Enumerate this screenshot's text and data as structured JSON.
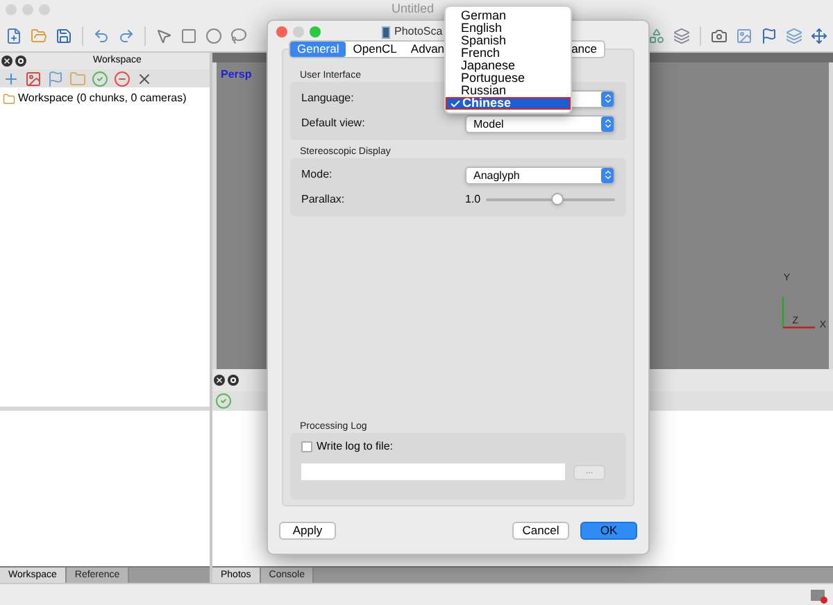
{
  "window": {
    "title": "Untitled"
  },
  "workspace_panel": {
    "title": "Workspace",
    "tree": [
      {
        "label": "Workspace (0 chunks, 0 cameras)"
      }
    ],
    "tabs": [
      {
        "label": "Workspace",
        "selected": true
      },
      {
        "label": "Reference",
        "selected": false
      }
    ]
  },
  "viewport": {
    "tab": "Persp",
    "axes": {
      "y": "Y",
      "z": "Z",
      "x": "X"
    }
  },
  "photos_panel": {
    "tabs": [
      {
        "label": "Photos",
        "selected": true
      },
      {
        "label": "Console",
        "selected": false
      }
    ]
  },
  "dialog": {
    "title": "PhotoSca",
    "tabs": [
      {
        "label": "General",
        "selected": true
      },
      {
        "label": "OpenCL",
        "selected": false
      },
      {
        "label": "Advan",
        "selected": false
      },
      {
        "label": "ance",
        "selected": false
      }
    ],
    "user_interface": {
      "title": "User Interface",
      "language": {
        "label": "Language:"
      },
      "default_view": {
        "label": "Default view:",
        "value": "Model"
      }
    },
    "stereoscopic_display": {
      "title": "Stereoscopic Display",
      "mode": {
        "label": "Mode:",
        "value": "Anaglyph"
      },
      "parallax": {
        "label": "Parallax:",
        "reading": "1.0",
        "level": 0.55
      }
    },
    "processing_log": {
      "title": "Processing Log",
      "write_log": {
        "label": "Write log to file:",
        "checked": false
      },
      "browse_button": "..."
    },
    "buttons": [
      {
        "label": "Apply",
        "kind": "plain"
      },
      {
        "label": "Cancel",
        "kind": "plain"
      },
      {
        "label": "OK",
        "kind": "default"
      }
    ]
  },
  "language_menu": {
    "items": [
      {
        "label": "German",
        "selected": false
      },
      {
        "label": "English",
        "selected": false
      },
      {
        "label": "Spanish",
        "selected": false
      },
      {
        "label": "French",
        "selected": false
      },
      {
        "label": "Japanese",
        "selected": false
      },
      {
        "label": "Portuguese",
        "selected": false
      },
      {
        "label": "Russian",
        "selected": false
      },
      {
        "label": "Chinese",
        "selected": true
      }
    ]
  }
}
